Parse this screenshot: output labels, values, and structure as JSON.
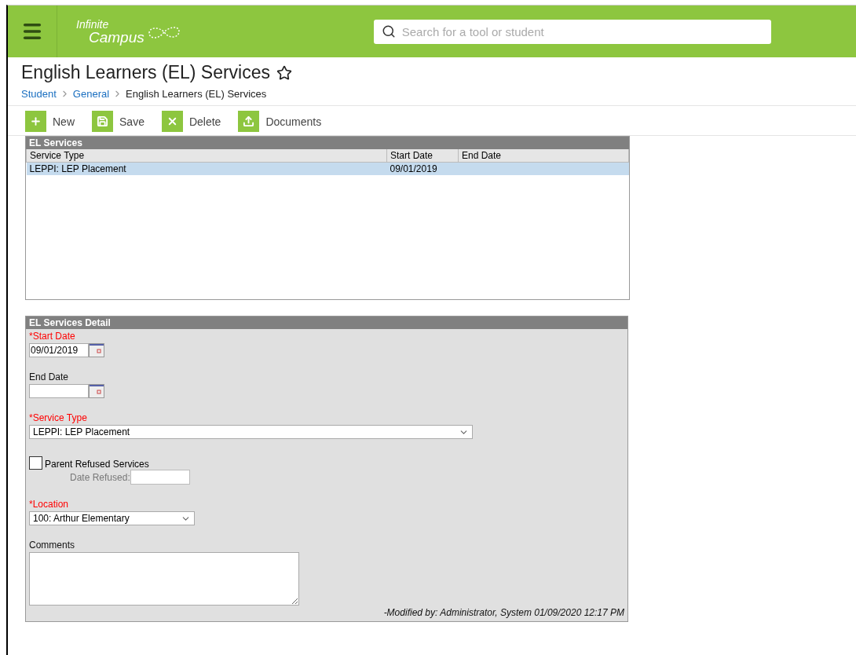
{
  "header": {
    "logo": {
      "line_1": "Infinite",
      "line_2": "Campus"
    },
    "search": {
      "placeholder": "Search for a tool or student"
    }
  },
  "page": {
    "title": "English Learners (EL) Services",
    "favorite": false,
    "breadcrumbs": [
      {
        "label": "Student",
        "link": true
      },
      {
        "label": "General",
        "link": true
      },
      {
        "label": "English Learners (EL) Services",
        "link": false
      }
    ]
  },
  "toolbar": [
    {
      "kind": "new",
      "label": "New"
    },
    {
      "kind": "save",
      "label": "Save"
    },
    {
      "kind": "delete",
      "label": "Delete"
    },
    {
      "kind": "documents",
      "label": "Documents"
    }
  ],
  "services": {
    "title": "EL Services",
    "columns": [
      "Service Type",
      "Start Date",
      "End Date"
    ],
    "rows": [
      {
        "cells": [
          "LEPPI: LEP Placement",
          "09/01/2019",
          ""
        ],
        "selected": true
      }
    ]
  },
  "detail": {
    "title": "EL Services Detail",
    "fields": [
      {
        "kind": "date",
        "label": "*Start Date",
        "required": true,
        "value": "09/01/2019"
      },
      {
        "kind": "date",
        "label": "End Date",
        "required": false
      },
      {
        "kind": "select",
        "label": "*Service Type",
        "required": true,
        "value": "LEPPI: LEP Placement",
        "wide": true
      },
      {
        "kind": "checkbox",
        "label": "Parent Refused Services",
        "checked": false,
        "sub_label": "Date Refused:"
      },
      {
        "kind": "select",
        "label": "*Location",
        "required": true,
        "value": "100: Arthur Elementary",
        "wide": false
      },
      {
        "kind": "textarea",
        "label": "Comments",
        "required": false
      }
    ],
    "modified": "-Modified by: Administrator, System 01/09/2020 12:17 PM"
  }
}
